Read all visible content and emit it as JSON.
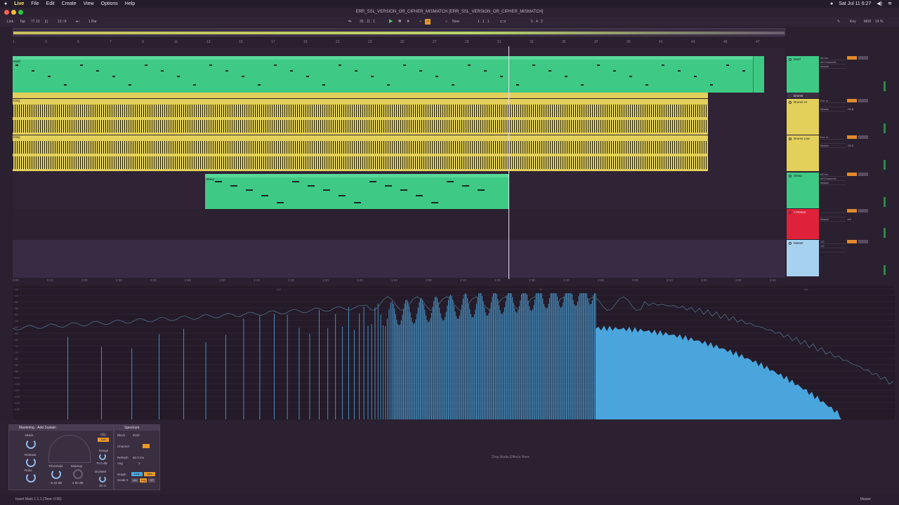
{
  "menubar": {
    "app": "Live",
    "items": [
      "File",
      "Edit",
      "Create",
      "View",
      "Options",
      "Help"
    ],
    "clock": "Sat Jul 11  6:27"
  },
  "window": {
    "title": "ERR_SSL_VERSION_OR_CIPHER_MISMATCH  [ERR_SSL_VERSION_OR_CIPHER_MISMATCH]"
  },
  "controlbar": {
    "link": "Link",
    "tap": "Tap",
    "tempo": "77.13",
    "signature": "13 / 8",
    "quantize": "1 Bar",
    "position": "35 . 11 . 1",
    "new_label": "New",
    "loop_start": "1 . 1 . 1",
    "loop_length": "5 . 4 . 0",
    "key": "Key",
    "midi": "MIDI",
    "cpu": "14 %"
  },
  "ruler": {
    "bars": [
      "1",
      "3",
      "5",
      "7",
      "9",
      "11",
      "13",
      "15",
      "17",
      "19",
      "21",
      "23",
      "25",
      "27",
      "29",
      "31",
      "33",
      "35",
      "37",
      "39",
      "41",
      "43",
      "45",
      "47"
    ]
  },
  "tracks": [
    {
      "name": "Motif",
      "color": "#3ec985",
      "clip_label": "Motif",
      "input": "All Ins",
      "channel": "All Channels",
      "out": "Master"
    },
    {
      "name": "Drums",
      "color": "#e3d05a",
      "clip_label": "",
      "input": "",
      "channel": "",
      "out": ""
    },
    {
      "name": "Drums Hi",
      "color": "#e3d05a",
      "clip_label": "ESQ",
      "input": "Ext. In",
      "channel": "",
      "out": "Master",
      "vol": "-33.8"
    },
    {
      "name": "Drums Low",
      "color": "#e3d05a",
      "clip_label": "ESQ",
      "input": "Ext. In",
      "channel": "",
      "out": "Master",
      "vol": "-15.0"
    },
    {
      "name": "Sharp",
      "color": "#3ec985",
      "clip_label": "Sharp",
      "input": "All Ins",
      "channel": "All Channels",
      "out": "Master"
    },
    {
      "name": "A Return",
      "color": "#e0213a",
      "clip_label": "",
      "input": "",
      "channel": "",
      "out": "Master",
      "vol": "-inf"
    },
    {
      "name": "Master",
      "color": "#a6d2f0",
      "clip_label": "",
      "input": "1/2",
      "channel": "1/2",
      "out": ""
    }
  ],
  "time_ruler": [
    "0:00",
    "0:10",
    "0:20",
    "0:30",
    "0:40",
    "0:50",
    "1:00",
    "1:10",
    "1:20",
    "1:30",
    "1:40",
    "1:50",
    "2:00",
    "2:10",
    "2:20",
    "2:30",
    "2:40",
    "2:50",
    "3:00",
    "3:10",
    "3:20",
    "3:30",
    "3:40"
  ],
  "spectrum": {
    "db_labels": [
      "-18",
      "-24",
      "-30",
      "-36",
      "-42",
      "-48",
      "-54",
      "-60",
      "-66",
      "-72",
      "-78",
      "-84",
      "-90",
      "-96",
      "-102",
      "-108",
      "-114",
      "-120",
      "-126",
      "-132"
    ],
    "hz_labels": [
      "100",
      "1k",
      "10k"
    ]
  },
  "devices": {
    "glue": {
      "title": "Mastering - Add Sustain",
      "attack": "Attack",
      "release": "Release",
      "ratio": "Ratio",
      "threshold": "Threshold",
      "makeup": "Makeup",
      "threshold_val": "-6.40 dB",
      "makeup_val": "2.00 dB",
      "clip": "Clip",
      "soft": "Soft",
      "range": "Range",
      "range_val": "70.0 dB",
      "drywet": "Dry/Wet",
      "drywet_val": "30 %"
    },
    "spectrum": {
      "title": "Spectrum",
      "block": "Block",
      "block_val": "8192",
      "channel": "Channel",
      "refresh": "Refresh",
      "refresh_val": "60.0 ms",
      "avg": "Avg",
      "avg_val": "1",
      "graph": "Graph",
      "scale_x": "Scale X",
      "scale_x_lin": "Lin",
      "scale_x_log": "Log",
      "scale_x_st": "ST",
      "line": "Line",
      "max": "Max"
    },
    "drop_hint": "Drop Audio Effects Here"
  },
  "status": {
    "left": "Insert Mark 1.1.1 (Time: 0:00)",
    "right": "Master"
  },
  "colors": {
    "green_clip": "#3ec985",
    "yellow_clip": "#e3d05a",
    "return_red": "#e0213a",
    "master_blue": "#a6d2f0",
    "spectrum_fill": "#4aa5dc",
    "accent_orange": "#e89a2a"
  }
}
